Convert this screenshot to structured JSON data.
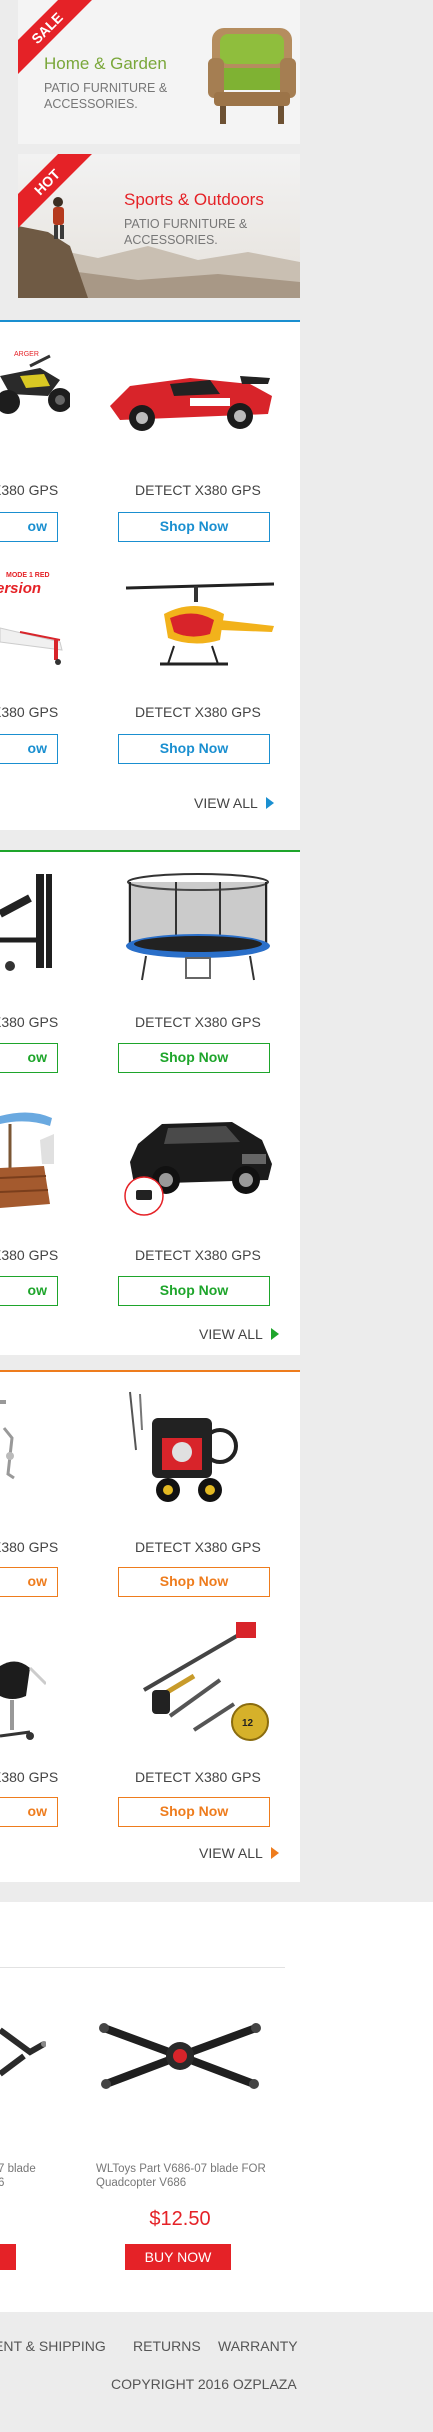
{
  "promos": [
    {
      "badge": "SALE",
      "title": "Home & Garden",
      "subtitle": "PATIO FURNITURE & ACCESSORIES.",
      "title_color": "#7aa73a"
    },
    {
      "badge": "HOT",
      "title": "Sports & Outdoors",
      "subtitle": "PATIO FURNITURE & ACCESSORIES.",
      "title_color": "#e52227"
    }
  ],
  "sections": [
    {
      "accent": "#1a8fd0",
      "view_all": "VIEW ALL",
      "button": "Shop Now",
      "rows": [
        {
          "left_name": "X380 GPS",
          "left_btn": "ow",
          "right_name": "DETECT X380 GPS",
          "left_badge": "MODE 1 RED",
          "left_badge2": "ersion"
        },
        {
          "left_name": "X380 GPS",
          "left_btn": "ow",
          "right_name": "DETECT X380 GPS"
        }
      ]
    },
    {
      "accent": "#1ea52b",
      "view_all": "VIEW ALL",
      "button": "Shop Now",
      "rows": [
        {
          "left_name": "X380 GPS",
          "left_btn": "ow",
          "right_name": "DETECT X380 GPS"
        },
        {
          "left_name": "X380 GPS",
          "left_btn": "ow",
          "right_name": "DETECT X380 GPS"
        }
      ]
    },
    {
      "accent": "#ee7c1d",
      "view_all": "VIEW ALL",
      "button": "Shop Now",
      "rows": [
        {
          "left_name": "X380 GPS",
          "left_btn": "ow",
          "right_name": "DETECT X380 GPS"
        },
        {
          "left_name": "X380 GPS",
          "left_btn": "ow",
          "right_name": "DETECT X380 GPS"
        }
      ]
    }
  ],
  "bottom_products": {
    "left_title": "7 blade\n6",
    "left_price": "",
    "right_title": "WLToys Part V686-07 blade FOR Quadcopter V686",
    "price": "$12.50",
    "buy_label": "BUY NOW",
    "price_color": "#e52227"
  },
  "footer": {
    "links": [
      "ENT & SHIPPING",
      "RETURNS",
      "WARRANTY"
    ],
    "copyright": "COPYRIGHT 2016 OZPLAZA"
  },
  "icons": {
    "view_all_arrow": "triangle-right"
  }
}
